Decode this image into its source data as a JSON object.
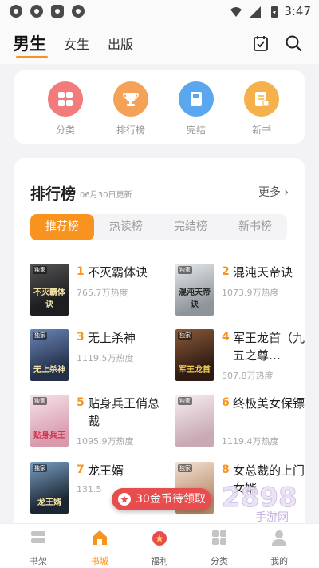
{
  "status_bar": {
    "time": "3:47"
  },
  "top_nav": {
    "tabs": [
      {
        "label": "男生",
        "active": true
      },
      {
        "label": "女生",
        "active": false
      },
      {
        "label": "出版",
        "active": false
      }
    ],
    "icons": [
      "checkin-icon",
      "search-icon"
    ]
  },
  "categories": [
    {
      "label": "分类",
      "icon": "category-icon",
      "color": "#f27b7b"
    },
    {
      "label": "排行榜",
      "icon": "trophy-icon",
      "color": "#f5a259"
    },
    {
      "label": "完结",
      "icon": "book-icon",
      "color": "#5aa7f0"
    },
    {
      "label": "新书",
      "icon": "new-book-icon",
      "color": "#f5b24c"
    }
  ],
  "ranking": {
    "title": "排行榜",
    "updated": "06月30日更新",
    "more": "更多",
    "filters": [
      {
        "label": "推荐榜",
        "active": true
      },
      {
        "label": "热读榜",
        "active": false
      },
      {
        "label": "完结榜",
        "active": false
      },
      {
        "label": "新书榜",
        "active": false
      }
    ],
    "books": [
      {
        "rank": "1",
        "title": "不灭霸体诀",
        "heat": "765.7万热度",
        "cover_text": "不灭霸体诀",
        "cover_color": "#2a2a2e"
      },
      {
        "rank": "2",
        "title": "混沌天帝诀",
        "heat": "1073.9万热度",
        "cover_text": "混沌天帝诀",
        "cover_color": "#bfc4c8"
      },
      {
        "rank": "3",
        "title": "无上杀神",
        "heat": "1119.5万热度",
        "cover_text": "无上杀神",
        "cover_color": "#3a4a66"
      },
      {
        "rank": "4",
        "title": "军王龙首（九五之尊…",
        "heat": "507.8万热度",
        "cover_text": "军王龙首",
        "cover_color": "#4b2a1e"
      },
      {
        "rank": "5",
        "title": "贴身兵王俏总裁",
        "heat": "1095.9万热度",
        "cover_text": "贴身兵王",
        "cover_color": "#e8cfd6"
      },
      {
        "rank": "6",
        "title": "终极美女保镖",
        "heat": "1119.4万热度",
        "cover_text": "",
        "cover_color": "#e9dfe3"
      },
      {
        "rank": "7",
        "title": "龙王婿",
        "heat": "131.5",
        "cover_text": "龙王婿",
        "cover_color": "#2b3a4a"
      },
      {
        "rank": "8",
        "title": "女总裁的上门女婿",
        "heat": "",
        "cover_text": "",
        "cover_color": "#e4c9b6"
      }
    ],
    "cover_tag": "独家"
  },
  "coin_banner": {
    "label": "30金币待领取"
  },
  "watermark": {
    "text": "2898",
    "sub": "手游网"
  },
  "bottom_nav": [
    {
      "label": "书架",
      "icon": "bookshelf-icon",
      "active": false
    },
    {
      "label": "书城",
      "icon": "bookstore-icon",
      "active": true
    },
    {
      "label": "福利",
      "icon": "gift-icon",
      "active": false
    },
    {
      "label": "分类",
      "icon": "category-icon",
      "active": false
    },
    {
      "label": "我的",
      "icon": "profile-icon",
      "active": false
    }
  ],
  "colors": {
    "accent": "#f7931e",
    "red": "#e84d4d"
  }
}
